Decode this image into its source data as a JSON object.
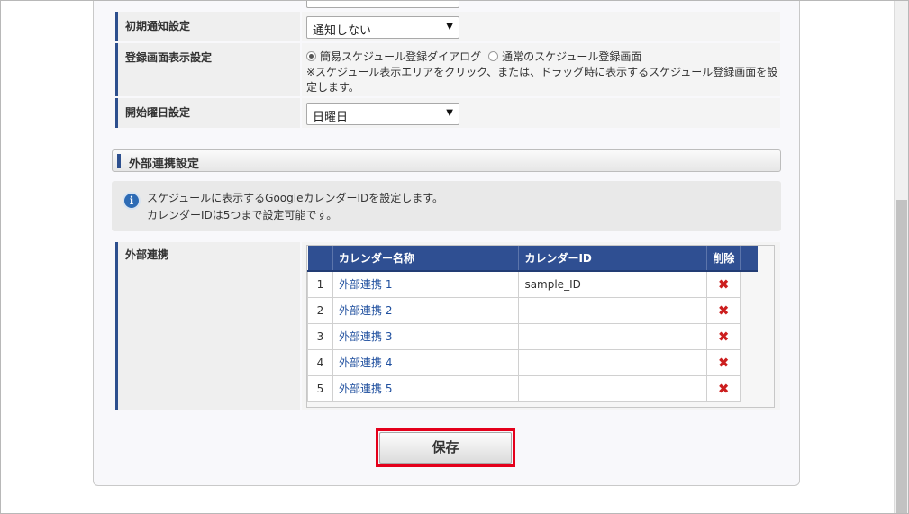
{
  "settings": {
    "initial_notice": {
      "label": "初期通知設定",
      "value": "通知しない"
    },
    "register_display": {
      "label": "登録画面表示設定",
      "option_simple": "簡易スケジュール登録ダイアログ",
      "option_normal": "通常のスケジュール登録画面",
      "selected": "option_simple",
      "note": "※スケジュール表示エリアをクリック、または、ドラッグ時に表示するスケジュール登録画面を設定します。"
    },
    "start_weekday": {
      "label": "開始曜日設定",
      "value": "日曜日"
    }
  },
  "external": {
    "section_title": "外部連携設定",
    "info_line1": "スケジュールに表示するGoogleカレンダーIDを設定します。",
    "info_line2": "カレンダーIDは5つまで設定可能です。",
    "row_label": "外部連携",
    "table": {
      "headers": {
        "name": "カレンダー名称",
        "id": "カレンダーID",
        "delete": "削除"
      },
      "rows": [
        {
          "num": "1",
          "name": "外部連携 1",
          "id": "sample_ID"
        },
        {
          "num": "2",
          "name": "外部連携 2",
          "id": ""
        },
        {
          "num": "3",
          "name": "外部連携 3",
          "id": ""
        },
        {
          "num": "4",
          "name": "外部連携 4",
          "id": ""
        },
        {
          "num": "5",
          "name": "外部連携 5",
          "id": ""
        }
      ]
    }
  },
  "actions": {
    "save_label": "保存"
  },
  "colors": {
    "accent": "#2d4f8e",
    "header_bg": "#2f4f92",
    "delete_icon": "#cc1f1f",
    "highlight": "#e4001b"
  },
  "icons": {
    "info": "info-icon",
    "delete": "delete-x-icon",
    "dropdown": "chevron-down-icon"
  }
}
